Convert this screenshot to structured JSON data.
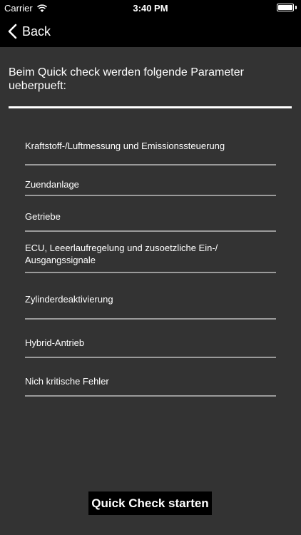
{
  "status_bar": {
    "carrier": "Carrier",
    "time": "3:40 PM"
  },
  "nav": {
    "back_label": "Back"
  },
  "intro": {
    "text": "Beim Quick check werden folgende Parameter ueberpueft:"
  },
  "parameters": [
    "Kraftstoff-/Luftmessung und Emissionssteuerung",
    "Zuendanlage",
    "Getriebe",
    "ECU, Leeerlaufregelung und zusoetzliche Ein-/ Ausgangssignale",
    "Zylinderdeaktivierung",
    "Hybrid-Antrieb",
    "Nich kritische Fehler"
  ],
  "actions": {
    "start_label": "Quick Check starten"
  },
  "colors": {
    "background": "#333333",
    "bar": "#000000",
    "text": "#ffffff",
    "separator": "#9a9a9a"
  }
}
